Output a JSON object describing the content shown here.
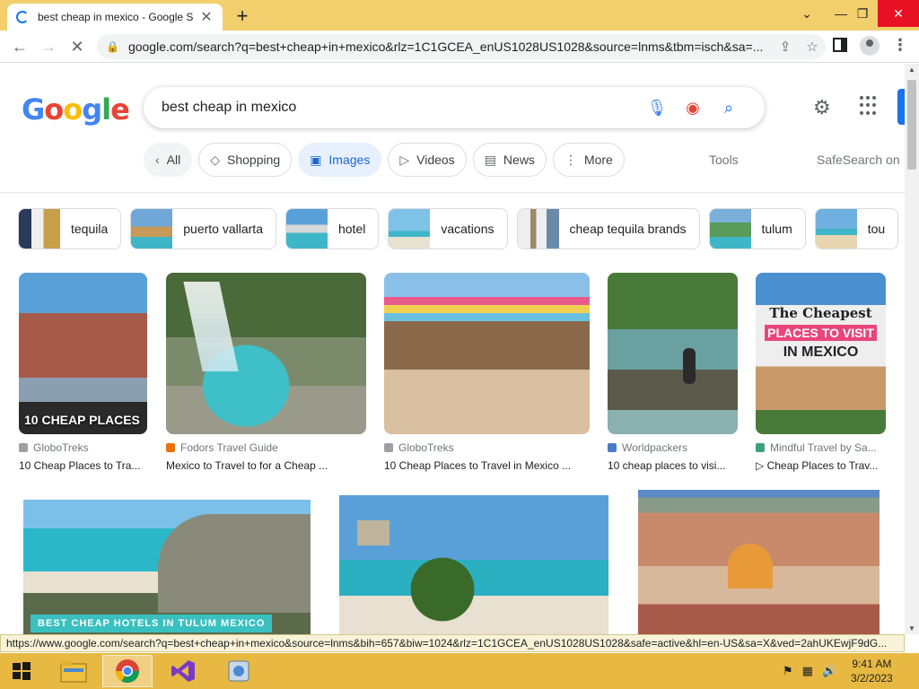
{
  "browser": {
    "tab_title": "best cheap in mexico - Google Se",
    "url": "google.com/search?q=best+cheap+in+mexico&rlz=1C1GCEA_enUS1028US1028&source=lnms&tbm=isch&sa=..."
  },
  "search": {
    "logo": "Google",
    "query": "best cheap in mexico"
  },
  "filters": [
    {
      "label": "All",
      "icon": "‹"
    },
    {
      "label": "Shopping",
      "icon": "◇"
    },
    {
      "label": "Images",
      "icon": "▣"
    },
    {
      "label": "Videos",
      "icon": "▷"
    },
    {
      "label": "News",
      "icon": "▤"
    },
    {
      "label": "More",
      "icon": "⋮"
    }
  ],
  "tools_label": "Tools",
  "safesearch_label": "SafeSearch on",
  "chips": [
    {
      "label": "tequila",
      "colors": [
        "#dfe7ef",
        "#3a5a7a"
      ]
    },
    {
      "label": "puerto vallarta",
      "colors": [
        "#6fa8d8",
        "#c89a5a"
      ]
    },
    {
      "label": "hotel",
      "colors": [
        "#5aa0d8",
        "#3fb6c8"
      ]
    },
    {
      "label": "vacations",
      "colors": [
        "#7ec2e8",
        "#e8e2d2"
      ]
    },
    {
      "label": "cheap tequila brands",
      "colors": [
        "#eeeeee",
        "#9a8a6a"
      ]
    },
    {
      "label": "tulum",
      "colors": [
        "#7ab0d8",
        "#5a9a5a"
      ]
    },
    {
      "label": "tou",
      "colors": [
        "#6fb0e0",
        "#e8d6b0"
      ]
    }
  ],
  "results": [
    {
      "source": "GloboTreks",
      "title": "10 Cheap Places to Tra...",
      "overlay": "10 CHEAP PLACES",
      "fav": "#9aa0a6"
    },
    {
      "source": "Fodors Travel Guide",
      "title": "Mexico to Travel to for a Cheap ...",
      "overlay": "",
      "fav": "#e8710a"
    },
    {
      "source": "GloboTreks",
      "title": "10 Cheap Places to Travel in Mexico ...",
      "overlay": "",
      "fav": "#9aa0a6"
    },
    {
      "source": "Worldpackers",
      "title": "10 cheap places to visi...",
      "overlay": "",
      "fav": "#4a7ac8"
    },
    {
      "source": "Mindful Travel by Sa...",
      "title": "▷ Cheap Places to Trav...",
      "overlay": "",
      "fav": "#3aa080"
    },
    {
      "source": "",
      "title": "",
      "overlay": "BEST CHEAP HOTELS IN TULUM MEXICO",
      "fav": ""
    },
    {
      "source": "",
      "title": "",
      "overlay": "",
      "fav": ""
    },
    {
      "source": "",
      "title": "",
      "overlay": "",
      "fav": ""
    }
  ],
  "poster": {
    "line1": "The Cheapest",
    "line2": "PLACES TO VISIT",
    "line3": "IN MEXICO"
  },
  "status_url": "https://www.google.com/search?q=best+cheap+in+mexico&source=lnms&bih=657&biw=1024&rlz=1C1GCEA_enUS1028US1028&safe=active&hl=en-US&sa=X&ved=2ahUKEwjF9dG...",
  "clock": {
    "time": "9:41 AM",
    "date": "3/2/2023"
  },
  "colors": {
    "tabstrip": "#f2cf6c",
    "taskbar": "#e8b942",
    "accent": "#1a73e8"
  }
}
